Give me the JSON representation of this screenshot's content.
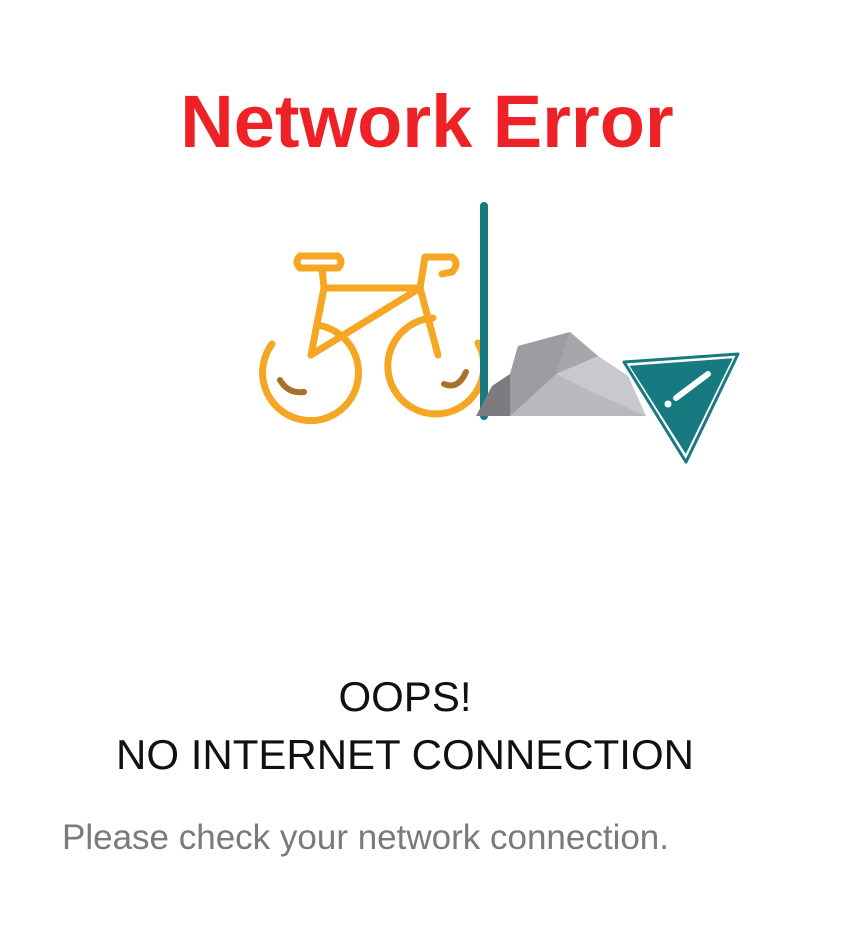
{
  "error_screen": {
    "title": "Network Error",
    "message_line1": "OOPS!",
    "message_line2": "NO INTERNET CONNECTION",
    "hint": "Please check your network connection."
  },
  "illustration": {
    "icons": [
      "bicycle-icon",
      "pole-icon",
      "rock-icon",
      "warning-sign-icon"
    ],
    "colors": {
      "bicycle": "#f5a623",
      "bicycle_accent": "#a8712a",
      "pole": "#167a80",
      "rock_light": "#b9b9bd",
      "rock_mid": "#9c9ca1",
      "rock_dark": "#7b7b80",
      "sign": "#167a80"
    }
  },
  "colors": {
    "title": "#ee2127",
    "message": "#111111",
    "hint": "#7a7a7a",
    "background": "#ffffff"
  }
}
